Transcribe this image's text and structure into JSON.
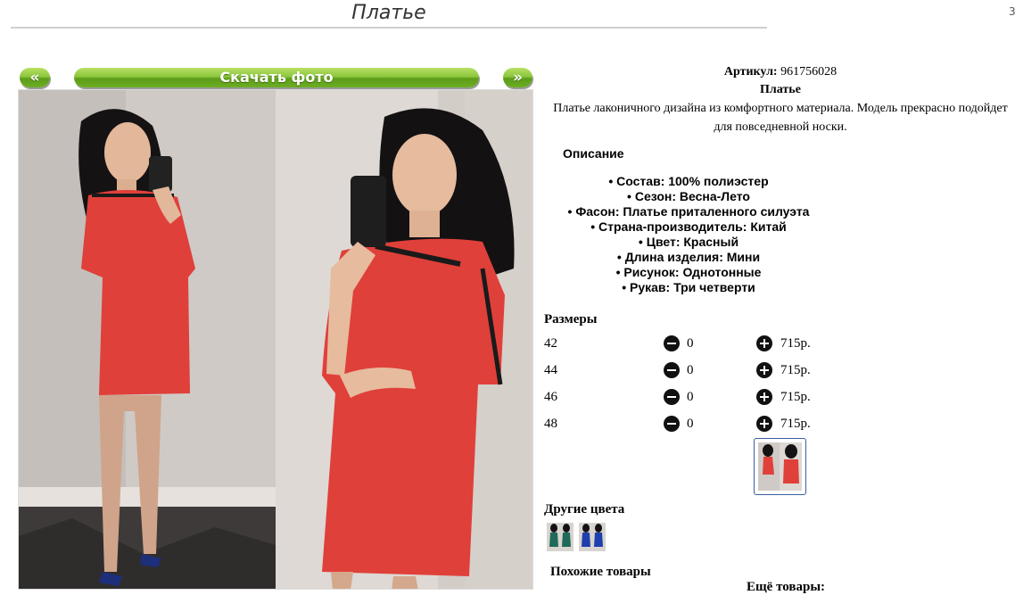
{
  "page": {
    "title": "Платье",
    "corner_mark": "3"
  },
  "nav": {
    "prev_label": "«",
    "download_label": "Скачать фото",
    "next_label": "»"
  },
  "product": {
    "sku_label": "Артикул:",
    "sku_value": "961756028",
    "name": "Платье",
    "description": "Платье лаконичного дизайна из комфортного материала. Модель прекрасно подойдет для повседневной носки."
  },
  "details": {
    "heading": "Описание",
    "items": [
      "Состав: 100% полиэстер",
      "Сезон: Весна-Лето",
      "Фасон: Платье приталенного силуэта",
      "Страна-производитель: Китай",
      "Цвет: Красный",
      "Длина изделия: Мини",
      "Рисунок: Однотонные",
      "Рукав: Три четверти"
    ]
  },
  "sizes": {
    "heading": "Размеры",
    "rows": [
      {
        "size": "42",
        "qty": "0",
        "price": "715р."
      },
      {
        "size": "44",
        "qty": "0",
        "price": "715р."
      },
      {
        "size": "46",
        "qty": "0",
        "price": "715р."
      },
      {
        "size": "48",
        "qty": "0",
        "price": "715р."
      }
    ]
  },
  "other_colors": {
    "heading": "Другие цвета",
    "swatches": [
      "#1f6a5a",
      "#1f3fae"
    ]
  },
  "similar": {
    "heading": "Похожие товары"
  },
  "more": {
    "heading": "Ещё товары:"
  },
  "colors": {
    "accent_green": "#6cae23",
    "dress_red": "#e0403a",
    "thumb_border": "#3a5fa0"
  }
}
